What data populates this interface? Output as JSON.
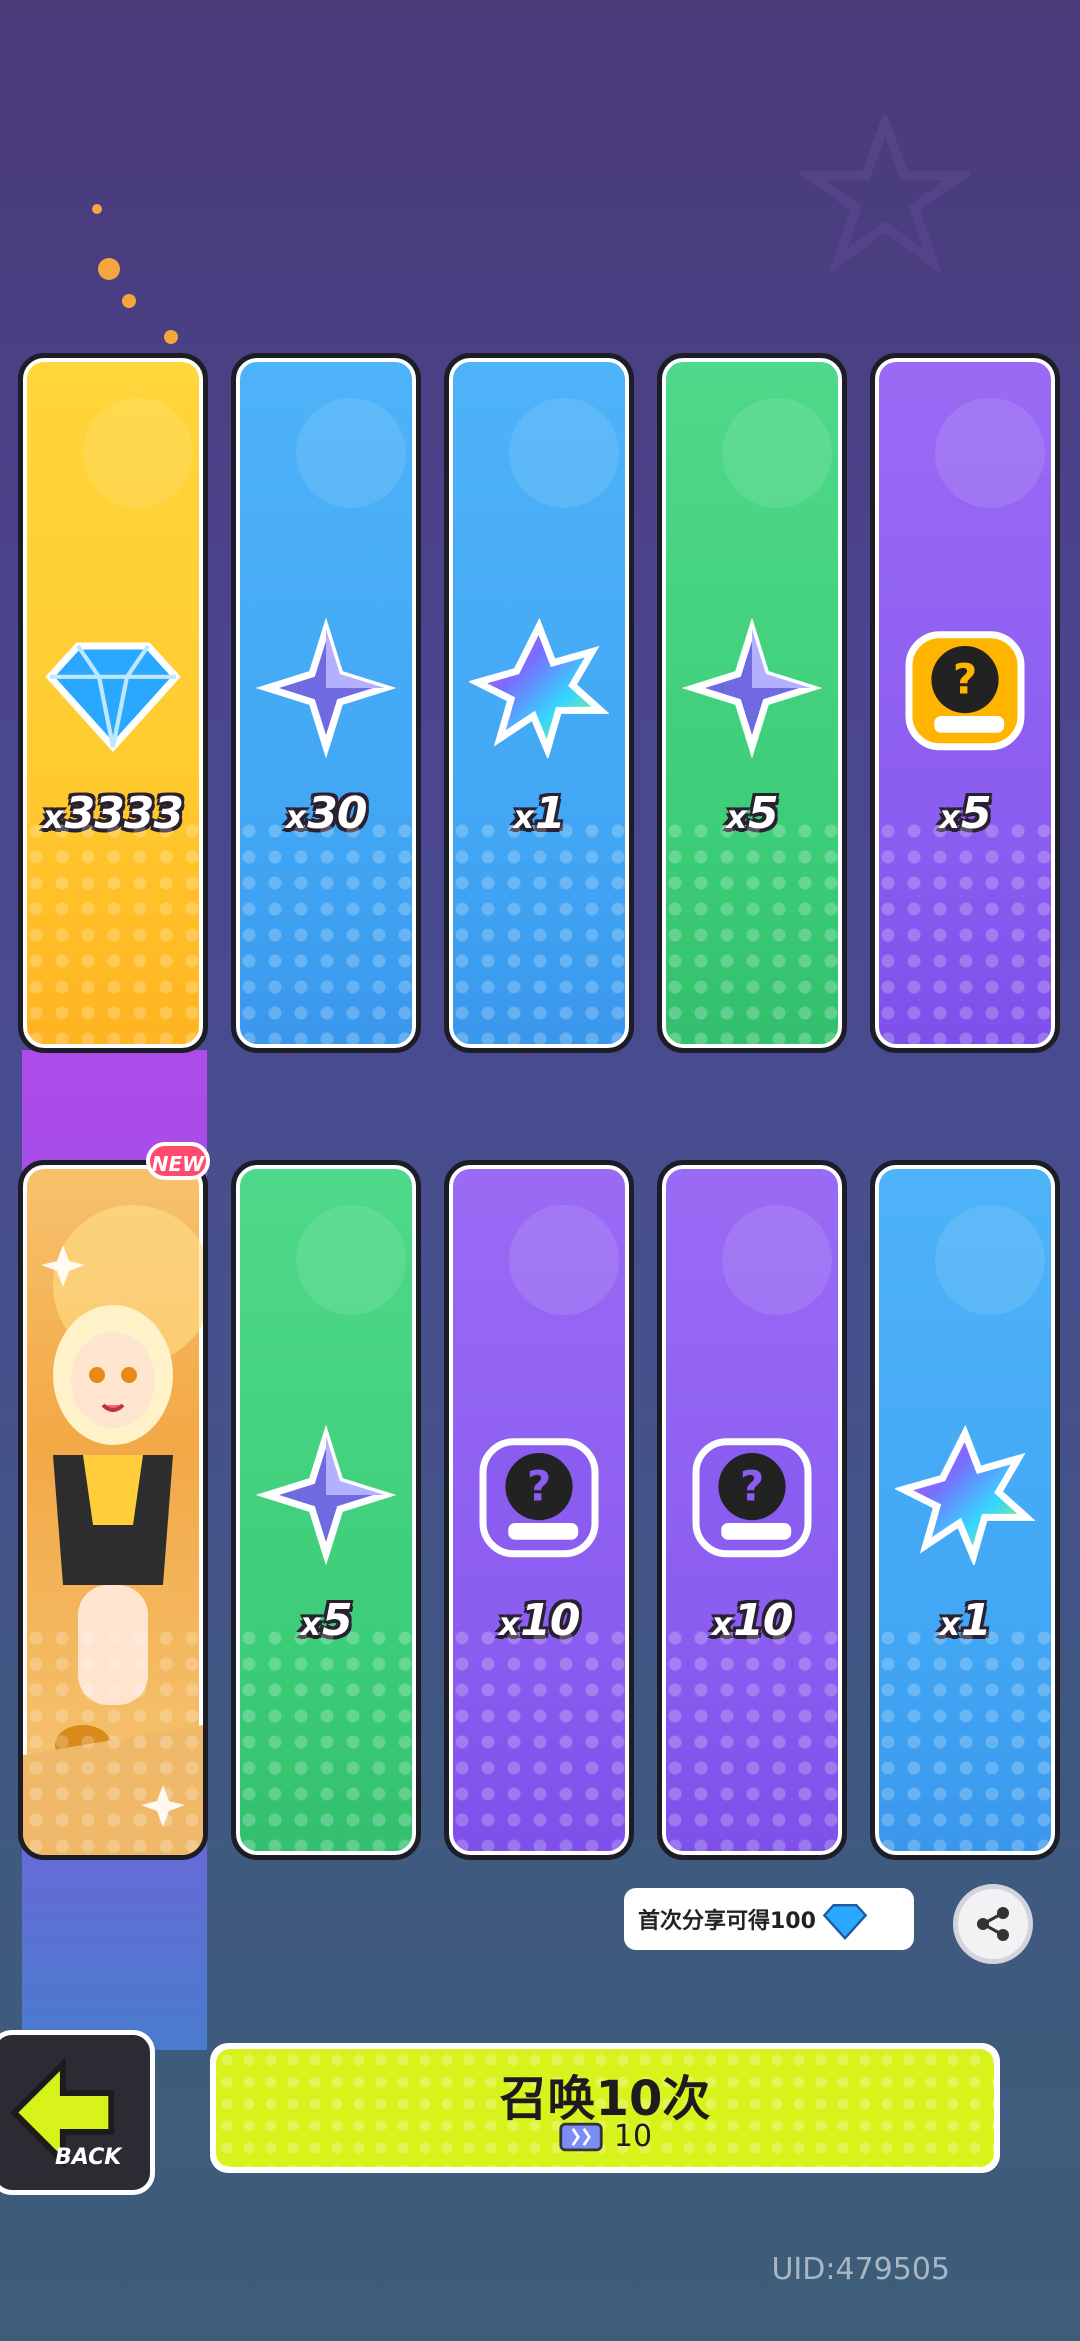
{
  "top_row": [
    {
      "icon": "diamond-icon",
      "quantity": "3333",
      "color": "yellow"
    },
    {
      "icon": "star-shard-icon",
      "quantity": "30",
      "color": "blue"
    },
    {
      "icon": "rainbow-leaf-icon",
      "quantity": "1",
      "color": "blue"
    },
    {
      "icon": "star-shard-icon",
      "quantity": "5",
      "color": "green"
    },
    {
      "icon": "deity-mystery-icon",
      "quantity": "5",
      "color": "purple"
    }
  ],
  "bottom_row": [
    {
      "icon": "character-portrait",
      "badge": "NEW",
      "color": "orange"
    },
    {
      "icon": "star-shard-icon",
      "quantity": "5",
      "color": "green"
    },
    {
      "icon": "deity-mystery-icon",
      "quantity": "10",
      "color": "purple"
    },
    {
      "icon": "deity-mystery-icon",
      "quantity": "10",
      "color": "purple"
    },
    {
      "icon": "rainbow-leaf-icon",
      "quantity": "1",
      "color": "blue"
    }
  ],
  "quantity_prefix": "x",
  "share": {
    "text": "首次分享可得100",
    "icon": "share-icon"
  },
  "back_button": {
    "label": "BACK"
  },
  "summon_button": {
    "label": "召唤10次",
    "cost": "10",
    "cost_icon": "ticket-icon"
  },
  "uid": "UID:479505",
  "colors": {
    "yellow": "#ffd63c",
    "blue": "#41a6f4",
    "green": "#3ccd78",
    "purple": "#8a5cf0",
    "summon": "#d8f21c"
  }
}
